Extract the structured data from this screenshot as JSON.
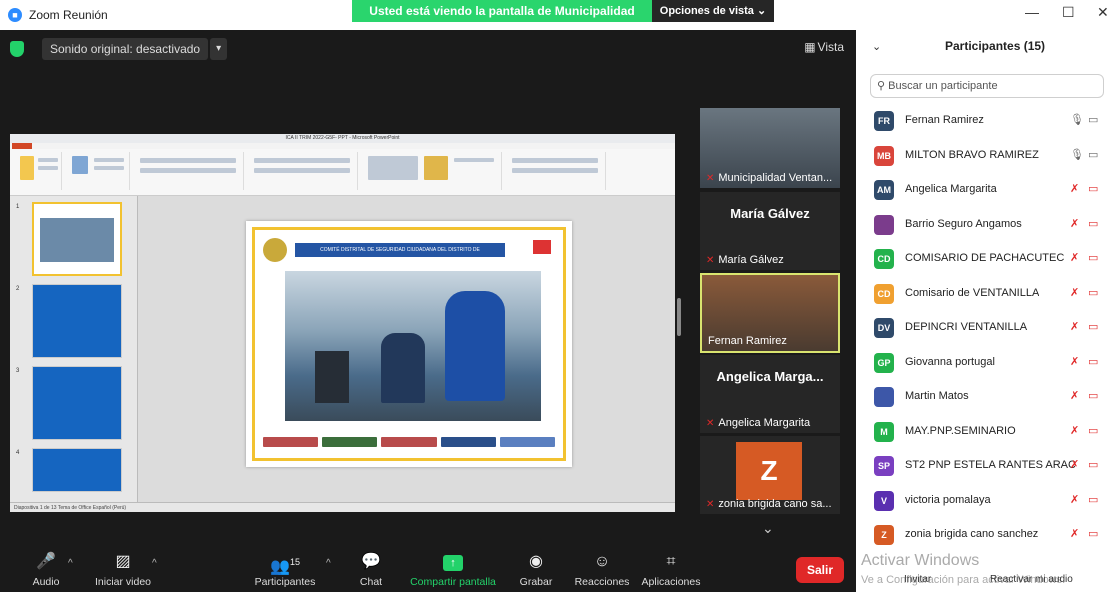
{
  "app": {
    "title": "Zoom Reunión",
    "logo": "camera-icon",
    "window_controls": [
      "—",
      "☐",
      "✕"
    ]
  },
  "banner": {
    "text": "Usted está viendo la pantalla de Municipalidad Ventanilla",
    "color": "#2ad56d"
  },
  "view_options": {
    "label": "Opciones de vista ⌄"
  },
  "topbar": {
    "sound_label": "Sonido original: desactivado",
    "sound_caret": "▾",
    "view_label": "Vista",
    "view_icon": "grid-icon"
  },
  "ppt": {
    "title": "ICA II TRIM 2022-G5F- PPT - Microsoft PowerPoint",
    "slide_header": "COMITÉ DISTRITAL DE SEGURIDAD CIUDADANA DEL DISTRITO DE",
    "thumb_numbers": [
      "1",
      "2",
      "3",
      "4"
    ],
    "status": "Diapositiva 1 de 13   Tema de Office   Español (Perú)"
  },
  "tiles": [
    {
      "name": "Municipalidad Ventan...",
      "muted": true
    },
    {
      "big": "María Gálvez",
      "name": "María Gálvez",
      "muted": true
    },
    {
      "name": "Fernan Ramirez",
      "muted": false,
      "active": true
    },
    {
      "big": "Angelica Marga...",
      "name": "Angelica Margarita",
      "muted": true
    },
    {
      "avatar": "Z",
      "name": "zonia brigida cano sa...",
      "muted": true
    }
  ],
  "toolbar": {
    "audio": "Audio",
    "video": "Iniciar video",
    "participants": "Participantes",
    "participants_count": "15",
    "chat": "Chat",
    "share": "Compartir pantalla",
    "record": "Grabar",
    "reactions": "Reacciones",
    "apps": "Aplicaciones",
    "leave": "Salir"
  },
  "panel": {
    "title": "Participantes (15)",
    "search_placeholder": "Buscar un participante",
    "participants": [
      {
        "initials": "FR",
        "name": "Fernan Ramirez",
        "color": "#2f4a6a",
        "mic": "on"
      },
      {
        "initials": "MB",
        "name": "MILTON BRAVO RAMIREZ",
        "color": "#d9453b",
        "mic": "on"
      },
      {
        "initials": "AM",
        "name": "Angelica Margarita",
        "color": "#2f4a6a",
        "mic": "off"
      },
      {
        "initials": "",
        "name": "Barrio Seguro Angamos",
        "color": "#7b3c8c",
        "mic": "off"
      },
      {
        "initials": "CD",
        "name": "COMISARIO DE PACHACUTEC",
        "color": "#23b24c",
        "mic": "off"
      },
      {
        "initials": "CD",
        "name": "Comisario de VENTANILLA",
        "color": "#f0a030",
        "mic": "off"
      },
      {
        "initials": "DV",
        "name": "DEPINCRI VENTANILLA",
        "color": "#2f4a6a",
        "mic": "off"
      },
      {
        "initials": "GP",
        "name": "Giovanna portugal",
        "color": "#23b24c",
        "mic": "off"
      },
      {
        "initials": "",
        "name": "Martin Matos",
        "color": "#3d57a8",
        "mic": "off"
      },
      {
        "initials": "M",
        "name": "MAY.PNP.SEMINARIO",
        "color": "#23b24c",
        "mic": "off"
      },
      {
        "initials": "SP",
        "name": "ST2 PNP ESTELA RANTES ARAC...",
        "color": "#7a3fc0",
        "mic": "off"
      },
      {
        "initials": "V",
        "name": "victoria pomalaya",
        "color": "#5a2fb0",
        "mic": "off"
      },
      {
        "initials": "Z",
        "name": "zonia brigida cano sanchez",
        "color": "#d65a24",
        "mic": "off"
      }
    ],
    "activation_title": "Activar Windows",
    "activation_sub": "Ve a Configuración para activar Windows.",
    "invite": "Invitar",
    "unmute_me": "Reactivar mi audio"
  }
}
